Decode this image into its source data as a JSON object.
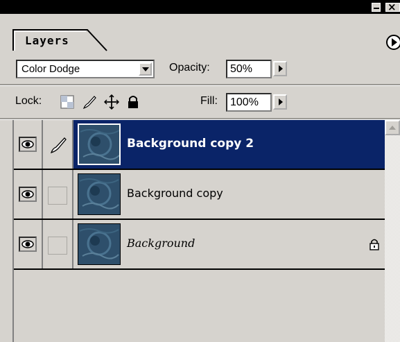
{
  "window": {
    "minimize_icon": "minimize-icon",
    "close_icon": "close-icon"
  },
  "tabs": [
    {
      "label": "Layers",
      "active": true
    }
  ],
  "panel_menu_icon": "right-arrow-circle-icon",
  "blend": {
    "mode": "Color Dodge",
    "opacity_label": "Opacity:",
    "opacity_value": "50%"
  },
  "lock": {
    "label": "Lock:",
    "icons": [
      "lock-transparent-pixels-icon",
      "lock-image-pixels-icon",
      "lock-position-icon",
      "lock-all-icon"
    ],
    "fill_label": "Fill:",
    "fill_value": "100%"
  },
  "layers": [
    {
      "name": "Background copy 2",
      "visible": true,
      "selected": true,
      "brush_icon": true,
      "locked": false
    },
    {
      "name": "Background copy",
      "visible": true,
      "selected": false,
      "brush_icon": false,
      "locked": false
    },
    {
      "name": "Background",
      "visible": true,
      "selected": false,
      "brush_icon": false,
      "locked": true
    }
  ],
  "colors": {
    "panel_bg": "#d6d3ce",
    "selected_row": "#0a2468",
    "titlebar": "#000000"
  }
}
